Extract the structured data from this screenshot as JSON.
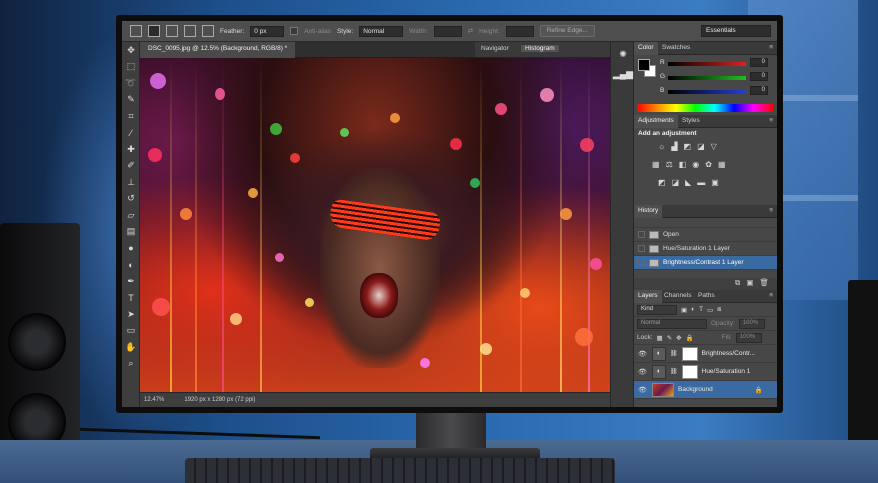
{
  "options_bar": {
    "feather_label": "Feather:",
    "feather_value": "0 px",
    "antialias_label": "Anti-alias",
    "style_label": "Style:",
    "style_value": "Normal",
    "width_label": "Width:",
    "height_label": "Height:",
    "refine_edge_label": "Refine Edge...",
    "workspace_value": "Essentials"
  },
  "document": {
    "tab_title": "DSC_0095.jpg @ 12.5% (Background, RGB/8) *",
    "zoom": "12.47%",
    "doc_info": "1920 px x 1280 px (72 ppi)"
  },
  "navigator_panel": {
    "tabs": [
      "Navigator",
      "Histogram"
    ]
  },
  "color_panel": {
    "tabs": [
      "Color",
      "Swatches"
    ],
    "channels": [
      {
        "label": "R",
        "value": "0",
        "color": "#e02020"
      },
      {
        "label": "G",
        "value": "0",
        "color": "#20c020"
      },
      {
        "label": "B",
        "value": "0",
        "color": "#2040e0"
      }
    ]
  },
  "adjustments_panel": {
    "tabs": [
      "Adjustments",
      "Styles"
    ],
    "title": "Add an adjustment"
  },
  "history_panel": {
    "tab": "History",
    "items": [
      {
        "label": "Open"
      },
      {
        "label": "Hue/Saturation 1 Layer"
      },
      {
        "label": "Brightness/Contrast 1 Layer"
      }
    ]
  },
  "layers_panel": {
    "tabs": [
      "Layers",
      "Channels",
      "Paths"
    ],
    "kind_label": "Kind",
    "blend_mode": "Normal",
    "opacity_label": "Opacity:",
    "opacity_value": "100%",
    "lock_label": "Lock:",
    "fill_label": "Fill:",
    "fill_value": "100%",
    "layers": [
      {
        "name": "Brightness/Contr..."
      },
      {
        "name": "Hue/Saturation 1"
      },
      {
        "name": "Background"
      }
    ]
  }
}
